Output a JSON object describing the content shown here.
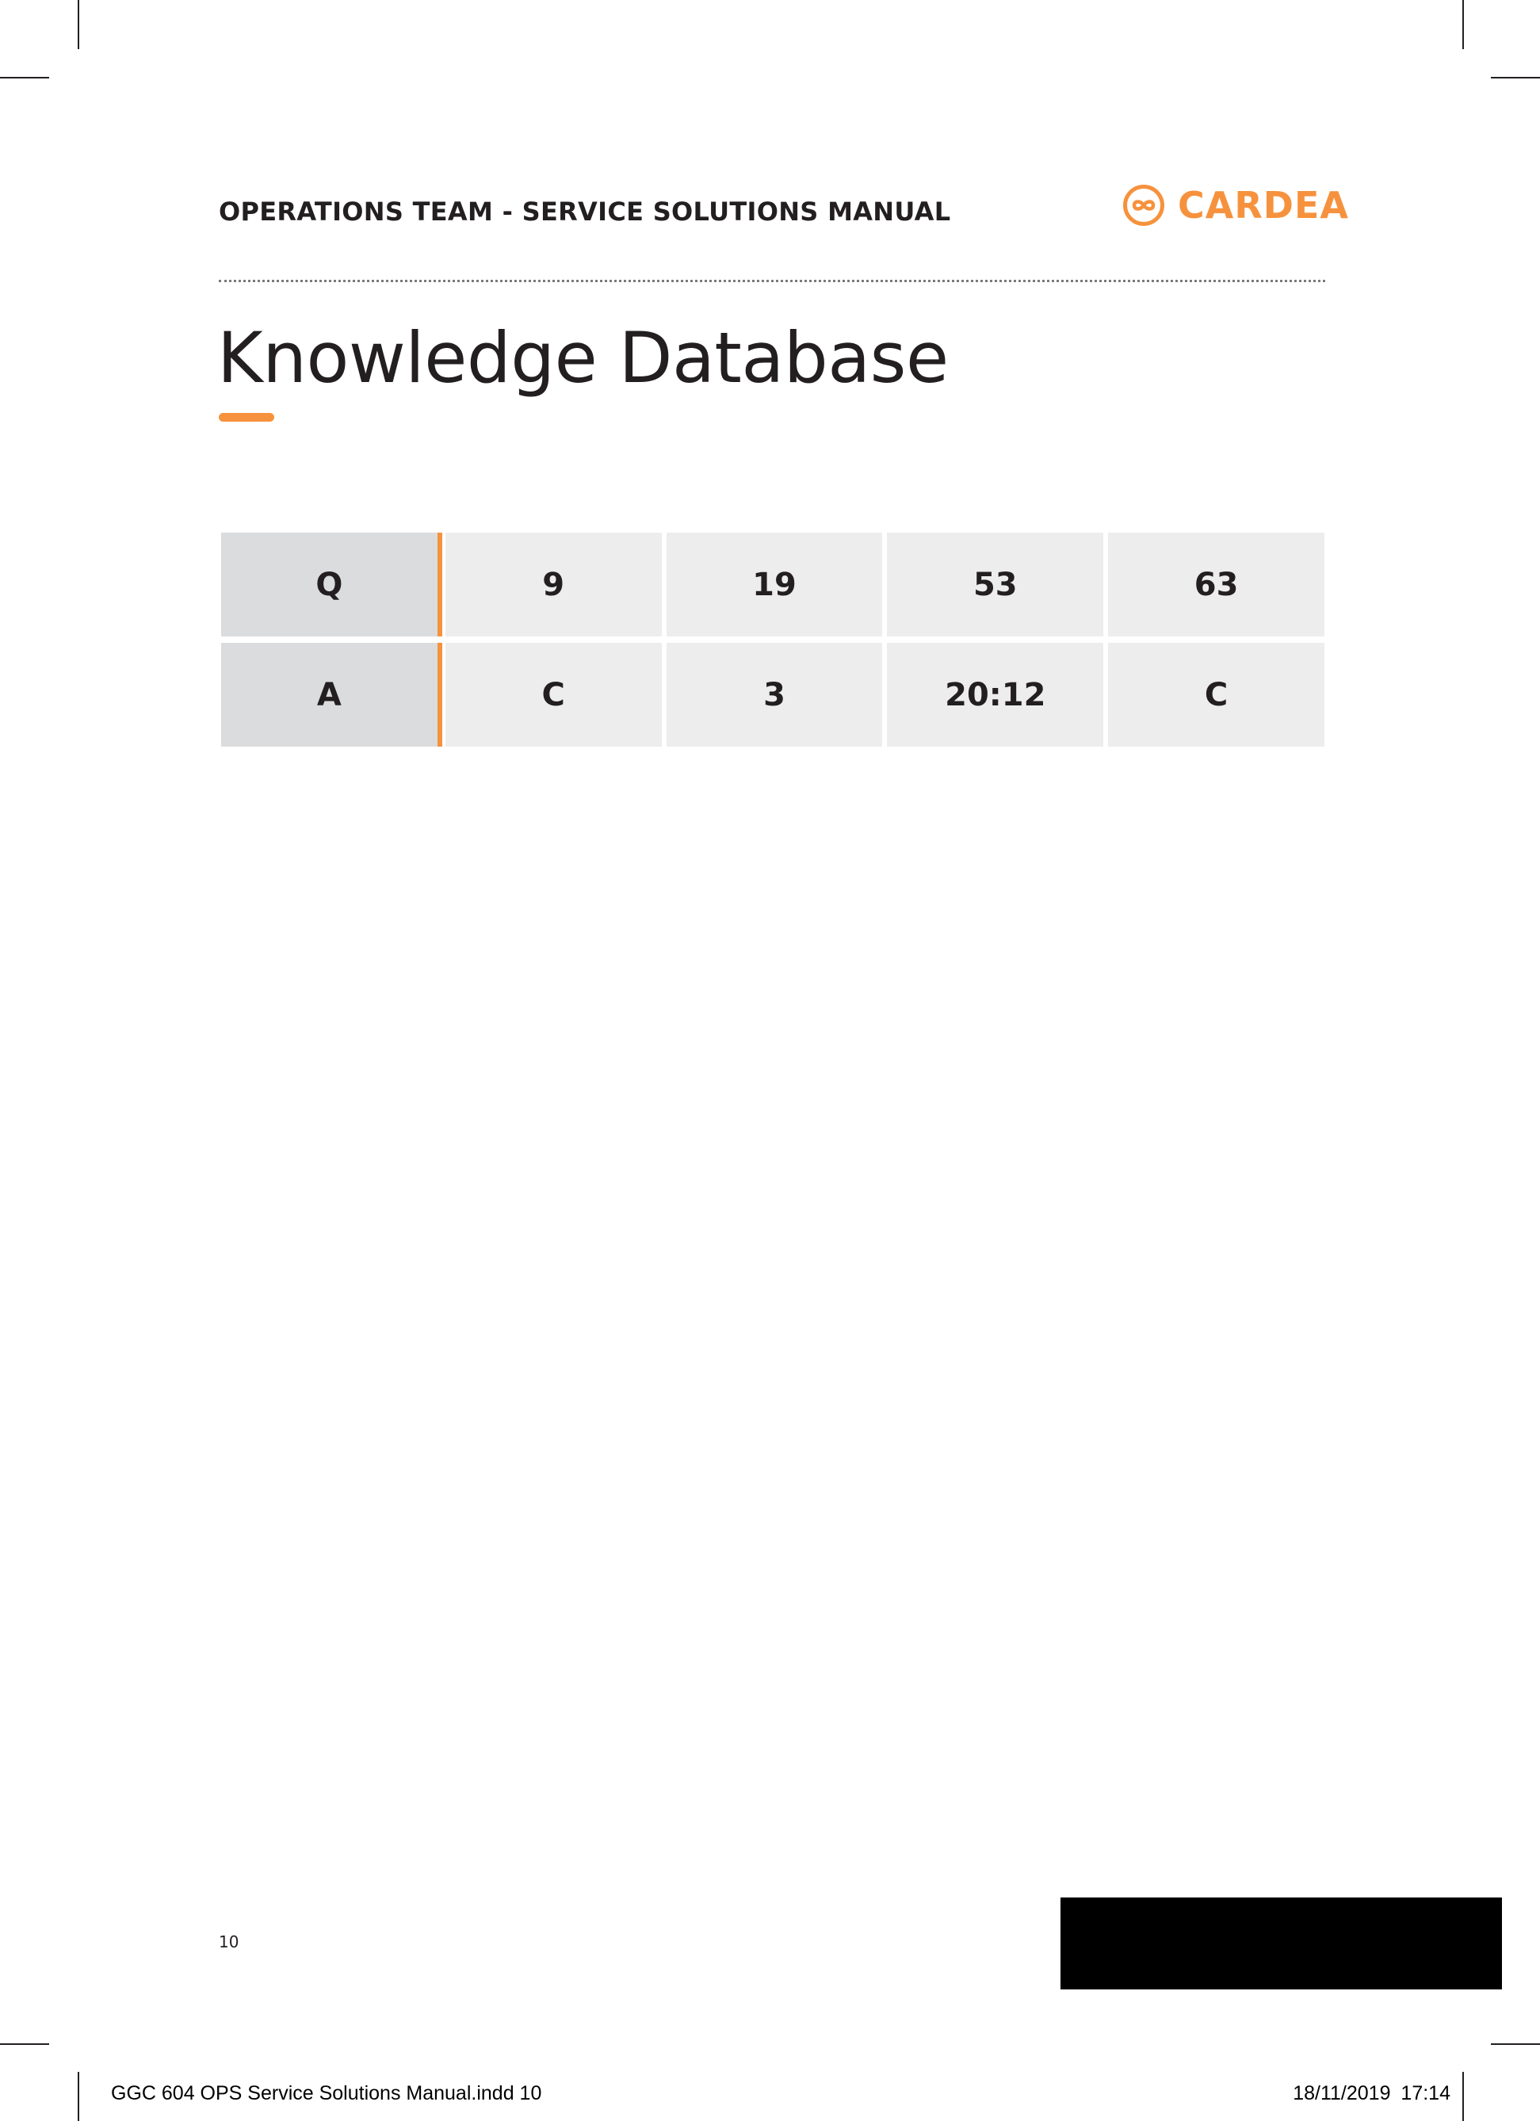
{
  "header": {
    "title": "OPERATIONS TEAM - SERVICE SOLUTIONS MANUAL",
    "logo_text": "CARDEA",
    "logo_icon": "infinity-circle-icon"
  },
  "page": {
    "title": "Knowledge Database",
    "page_number": "10"
  },
  "table": {
    "rows": [
      {
        "label": "Q",
        "values": [
          "9",
          "19",
          "53",
          "63"
        ]
      },
      {
        "label": "A",
        "values": [
          "C",
          "3",
          "20:12",
          "C"
        ]
      }
    ]
  },
  "slug": {
    "left": "GGC 604 OPS Service Solutions Manual.indd   10",
    "right": "18/11/2019   17:14"
  },
  "colors": {
    "accent": "#f6923d",
    "text": "#231f20",
    "cell": "#ededed",
    "header_cell": "#dbdcdd"
  }
}
